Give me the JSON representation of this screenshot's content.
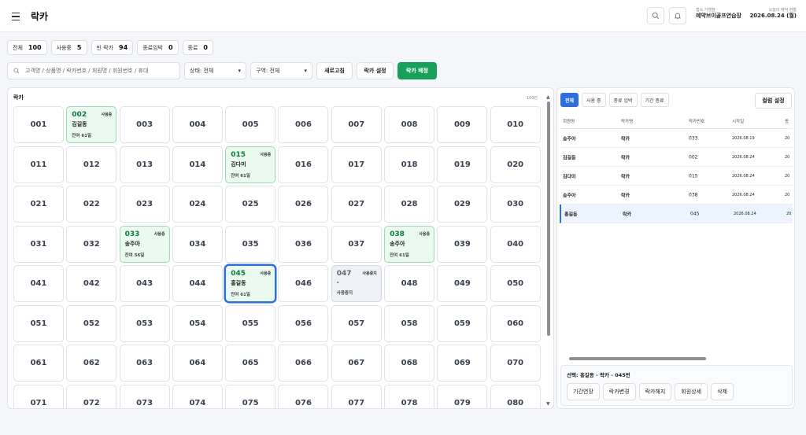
{
  "header": {
    "title": "락카",
    "org_label": "접속 가맹점",
    "org_value": "예약브이골프연습장",
    "date_label": "오늘의 예약 현황",
    "date_value": "2026.08.24 (월)"
  },
  "stats": [
    {
      "label": "전체",
      "value": "100"
    },
    {
      "label": "사용중",
      "value": "5"
    },
    {
      "label": "빈 락카",
      "value": "94"
    },
    {
      "label": "종료임박",
      "value": "0"
    },
    {
      "label": "종료",
      "value": "0"
    }
  ],
  "toolbar": {
    "search_placeholder": "고객명 / 상품명 / 락카번호 / 회원명 / 회원번호 / 휴대",
    "status_select": "상태: 전체",
    "zone_select": "구역: 전체",
    "refresh_label": "새로고침",
    "settings_label": "락카 설정",
    "assign_label": "락카 배정"
  },
  "locker_panel": {
    "title": "락카",
    "count_label": "100칸",
    "lockers": [
      {
        "no": "001"
      },
      {
        "no": "002",
        "status": "사용중",
        "name": "김길동",
        "remain": "잔여 61일"
      },
      {
        "no": "003"
      },
      {
        "no": "004"
      },
      {
        "no": "005"
      },
      {
        "no": "006"
      },
      {
        "no": "007"
      },
      {
        "no": "008"
      },
      {
        "no": "009"
      },
      {
        "no": "010"
      },
      {
        "no": "011"
      },
      {
        "no": "012"
      },
      {
        "no": "013"
      },
      {
        "no": "014"
      },
      {
        "no": "015",
        "status": "사용중",
        "name": "김다미",
        "remain": "잔여 61일"
      },
      {
        "no": "016"
      },
      {
        "no": "017"
      },
      {
        "no": "018"
      },
      {
        "no": "019"
      },
      {
        "no": "020"
      },
      {
        "no": "021"
      },
      {
        "no": "022"
      },
      {
        "no": "023"
      },
      {
        "no": "024"
      },
      {
        "no": "025"
      },
      {
        "no": "026"
      },
      {
        "no": "027"
      },
      {
        "no": "028"
      },
      {
        "no": "029"
      },
      {
        "no": "030"
      },
      {
        "no": "031"
      },
      {
        "no": "032"
      },
      {
        "no": "033",
        "status": "사용중",
        "name": "송주아",
        "remain": "잔여 56일"
      },
      {
        "no": "034"
      },
      {
        "no": "035"
      },
      {
        "no": "036"
      },
      {
        "no": "037"
      },
      {
        "no": "038",
        "status": "사용중",
        "name": "송주아",
        "remain": "잔여 61일"
      },
      {
        "no": "039"
      },
      {
        "no": "040"
      },
      {
        "no": "041"
      },
      {
        "no": "042"
      },
      {
        "no": "043"
      },
      {
        "no": "044"
      },
      {
        "no": "045",
        "status": "사용중",
        "name": "홍길동",
        "remain": "잔여 61일",
        "selected": true
      },
      {
        "no": "046"
      },
      {
        "no": "047",
        "status": "사용중지",
        "name": "-",
        "remain": "사용중지",
        "stopped": true
      },
      {
        "no": "048"
      },
      {
        "no": "049"
      },
      {
        "no": "050"
      },
      {
        "no": "051"
      },
      {
        "no": "052"
      },
      {
        "no": "053"
      },
      {
        "no": "054"
      },
      {
        "no": "055"
      },
      {
        "no": "056"
      },
      {
        "no": "057"
      },
      {
        "no": "058"
      },
      {
        "no": "059"
      },
      {
        "no": "060"
      },
      {
        "no": "061"
      },
      {
        "no": "062"
      },
      {
        "no": "063"
      },
      {
        "no": "064"
      },
      {
        "no": "065"
      },
      {
        "no": "066"
      },
      {
        "no": "067"
      },
      {
        "no": "068"
      },
      {
        "no": "069"
      },
      {
        "no": "070"
      },
      {
        "no": "071"
      },
      {
        "no": "072"
      },
      {
        "no": "073"
      },
      {
        "no": "074"
      },
      {
        "no": "075"
      },
      {
        "no": "076"
      },
      {
        "no": "077"
      },
      {
        "no": "078"
      },
      {
        "no": "079"
      },
      {
        "no": "080"
      }
    ]
  },
  "right_panel": {
    "tabs": [
      "전체",
      "사용 중",
      "종료 임박",
      "기간 종료"
    ],
    "column_settings": "컬럼 설정",
    "columns": [
      "회원명",
      "락카명",
      "락카번호",
      "시작일",
      "종"
    ],
    "rows": [
      {
        "member": "송주아",
        "locker": "락카",
        "no": "033",
        "start": "2026.08.19",
        "end": "20"
      },
      {
        "member": "김길동",
        "locker": "락카",
        "no": "002",
        "start": "2026.08.24",
        "end": "20"
      },
      {
        "member": "김다미",
        "locker": "락카",
        "no": "015",
        "start": "2026.08.24",
        "end": "20"
      },
      {
        "member": "송주아",
        "locker": "락카",
        "no": "038",
        "start": "2026.08.24",
        "end": "20"
      },
      {
        "member": "홍길동",
        "locker": "락카",
        "no": "045",
        "start": "2026.08.24",
        "end": "20"
      }
    ],
    "selected_label": "선택: 홍길동 - 락카 - 045번",
    "actions": [
      "기간연장",
      "락카변경",
      "락카해지",
      "회원상세",
      "삭제"
    ]
  }
}
